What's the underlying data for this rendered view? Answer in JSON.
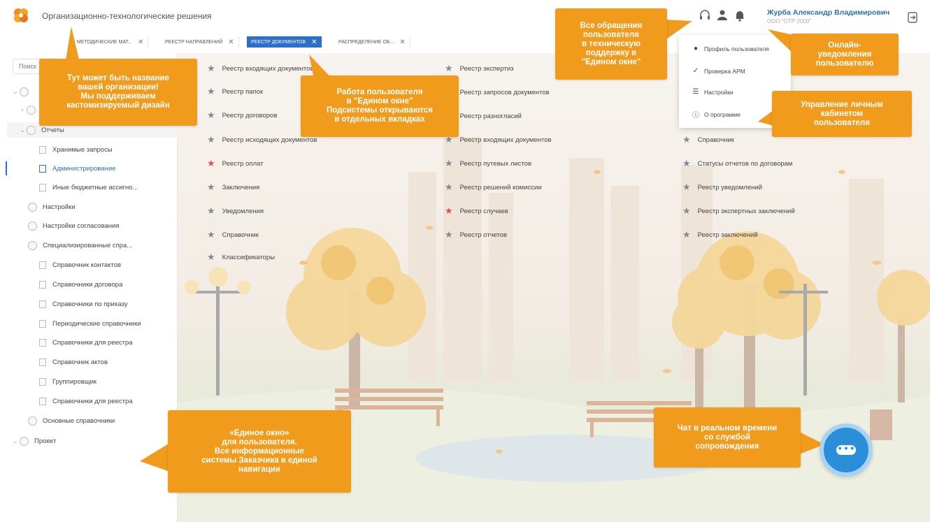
{
  "header": {
    "org_name": "Организационно-технологические решения",
    "user_name": "Журба Александр Владимирович",
    "user_org": "ООО \"ОТР 2000\""
  },
  "tabs": [
    {
      "label": "Методические мат...",
      "active": false
    },
    {
      "label": "Реестр направлений",
      "active": false
    },
    {
      "label": "Реестр документов",
      "active": true
    },
    {
      "label": "Распределение об...",
      "active": false
    }
  ],
  "sidebar": {
    "search_placeholder": "Поиск",
    "items": [
      {
        "label": "",
        "level": 0
      },
      {
        "label": "",
        "level": 0
      },
      {
        "label": "Отчеты",
        "level": 0
      },
      {
        "label": "Хранимые запросы",
        "level": 1
      },
      {
        "label": "Администрирование",
        "level": 1,
        "selected": true
      },
      {
        "label": "Иные бюджетные ассигно...",
        "level": 1
      },
      {
        "label": "Настройки",
        "level": 0
      },
      {
        "label": "Настройки согласования",
        "level": 0
      },
      {
        "label": "Специализированные спра...",
        "level": 0
      },
      {
        "label": "Справочник контактов",
        "level": 1
      },
      {
        "label": "Справочники договора",
        "level": 1
      },
      {
        "label": "Справочники по приказу",
        "level": 1
      },
      {
        "label": "Периодические справочники",
        "level": 1
      },
      {
        "label": "Справочники для реестра",
        "level": 1
      },
      {
        "label": "Справочник актов",
        "level": 1
      },
      {
        "label": "Группировщик",
        "level": 1
      },
      {
        "label": "Справочники для реестра",
        "level": 1
      },
      {
        "label": "Основные справочники",
        "level": 0
      },
      {
        "label": "Проект",
        "level": 0
      }
    ]
  },
  "registries": {
    "col1": [
      {
        "label": "Реестр входящих документов",
        "fav": false
      },
      {
        "label": "Реестр папок",
        "fav": false
      },
      {
        "label": "Реестр договоров",
        "fav": false
      },
      {
        "label": "Реестр исходящих документов",
        "fav": false
      },
      {
        "label": "Реестр оплат",
        "fav": true
      },
      {
        "label": "Заключения",
        "fav": false
      },
      {
        "label": "Уведомления",
        "fav": false
      },
      {
        "label": "Справочник",
        "fav": false
      },
      {
        "label": "Классификаторы",
        "fav": false
      }
    ],
    "col2": [
      {
        "label": "Реестр экспертиз",
        "fav": false
      },
      {
        "label": "Реестр запросов документов",
        "fav": false
      },
      {
        "label": "Реестр разногласий",
        "fav": false
      },
      {
        "label": "Реестр входящих документов",
        "fav": false
      },
      {
        "label": "Реестр путевых листов",
        "fav": false
      },
      {
        "label": "Реестр решений комиссии",
        "fav": false
      },
      {
        "label": "Реестр случаев",
        "fav": true
      },
      {
        "label": "Реестр отчетов",
        "fav": false
      }
    ],
    "col3": [
      {
        "label": "Справочник",
        "fav": false
      },
      {
        "label": "Статусы отчетов по договорам",
        "fav": false
      },
      {
        "label": "Реестр уведомлений",
        "fav": false
      },
      {
        "label": "Реестр экспертных заключений",
        "fav": false
      },
      {
        "label": "Реестр заключений",
        "fav": false
      }
    ]
  },
  "dropdown": {
    "items": [
      {
        "label": "Профиль пользователя",
        "icon": "user-icon"
      },
      {
        "label": "Проверка АРМ",
        "icon": "check-icon"
      },
      {
        "label": "Настройки",
        "icon": "settings-icon"
      },
      {
        "label": "О программе",
        "icon": "info-icon"
      }
    ]
  },
  "callouts": {
    "org_custom": "Тут может быть название\nвашей организации!\nМы поддерживаем\nкастомизируемый дизайн",
    "single_window_tabs": "Работа пользователя\nв \"Едином окне\"\nПодсистемы открываются\nв отдельных вкладках",
    "support_requests": "Все обращения\nпользователя\nв техническую\nподдержку в\n\"Едином окне\"",
    "notifications": "Онлайн-\nуведомления\nпользователю",
    "personal_cabinet": "Управление личным\nкабинетом\nпользователя",
    "single_window_nav": "«Единое окно»\nдля пользователя.\nВсе информационные\nсистемы Заказчика в единой\nнавигации",
    "realtime_chat": "Чат в реальном времени\nсо службой\nсопровождения"
  },
  "colors": {
    "accent": "#2d6ec8",
    "callout": "#f19b1c",
    "fav_star": "#e05050",
    "chat": "#2a8fd8"
  }
}
